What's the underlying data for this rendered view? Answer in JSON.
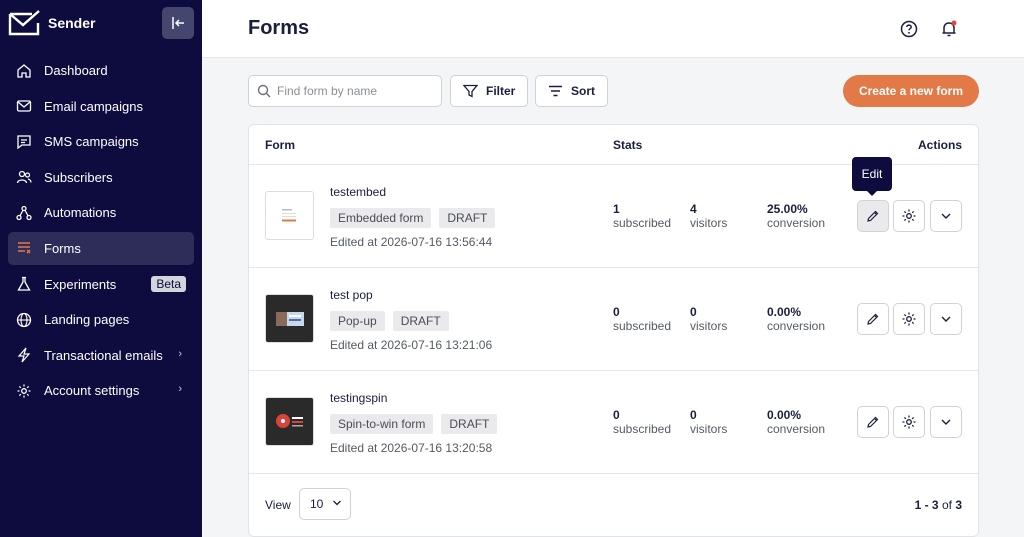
{
  "app": {
    "brand": "Sender"
  },
  "sidebar": {
    "items": [
      {
        "label": "Dashboard",
        "icon": "home-icon"
      },
      {
        "label": "Email campaigns",
        "icon": "mail-icon"
      },
      {
        "label": "SMS campaigns",
        "icon": "chat-icon"
      },
      {
        "label": "Subscribers",
        "icon": "users-icon"
      },
      {
        "label": "Automations",
        "icon": "automation-icon"
      },
      {
        "label": "Forms",
        "icon": "forms-icon",
        "active": true
      },
      {
        "label": "Experiments",
        "icon": "flask-icon",
        "badge": "Beta"
      },
      {
        "label": "Landing pages",
        "icon": "globe-icon"
      },
      {
        "label": "Transactional emails",
        "icon": "bolt-icon",
        "chevron": "›"
      },
      {
        "label": "Account settings",
        "icon": "gear-icon",
        "chevron": "›"
      }
    ]
  },
  "header": {
    "title": "Forms"
  },
  "toolbar": {
    "search_placeholder": "Find form by name",
    "filter_label": "Filter",
    "sort_label": "Sort",
    "create_label": "Create a new form"
  },
  "table": {
    "columns": {
      "form": "Form",
      "stats": "Stats",
      "actions": "Actions"
    },
    "rows": [
      {
        "name": "testembed",
        "type": "Embedded form",
        "status": "DRAFT",
        "edited": "Edited at 2026-07-16 13:56:44",
        "subscribed": "1",
        "subscribed_label": "subscribed",
        "visitors": "4",
        "visitors_label": "visitors",
        "conversion": "25.00%",
        "conversion_label": "conversion"
      },
      {
        "name": "test pop",
        "type": "Pop-up",
        "status": "DRAFT",
        "edited": "Edited at 2026-07-16 13:21:06",
        "subscribed": "0",
        "subscribed_label": "subscribed",
        "visitors": "0",
        "visitors_label": "visitors",
        "conversion": "0.00%",
        "conversion_label": "conversion"
      },
      {
        "name": "testingspin",
        "type": "Spin-to-win form",
        "status": "DRAFT",
        "edited": "Edited at 2026-07-16 13:20:58",
        "subscribed": "0",
        "subscribed_label": "subscribed",
        "visitors": "0",
        "visitors_label": "visitors",
        "conversion": "0.00%",
        "conversion_label": "conversion"
      }
    ]
  },
  "tooltip": {
    "edit": "Edit"
  },
  "footer": {
    "view_label": "View",
    "view_value": "10",
    "range": "1 - 3",
    "of": "of",
    "total": "3"
  },
  "colors": {
    "sidebar": "#0e0b3f",
    "accent": "#e27946"
  }
}
